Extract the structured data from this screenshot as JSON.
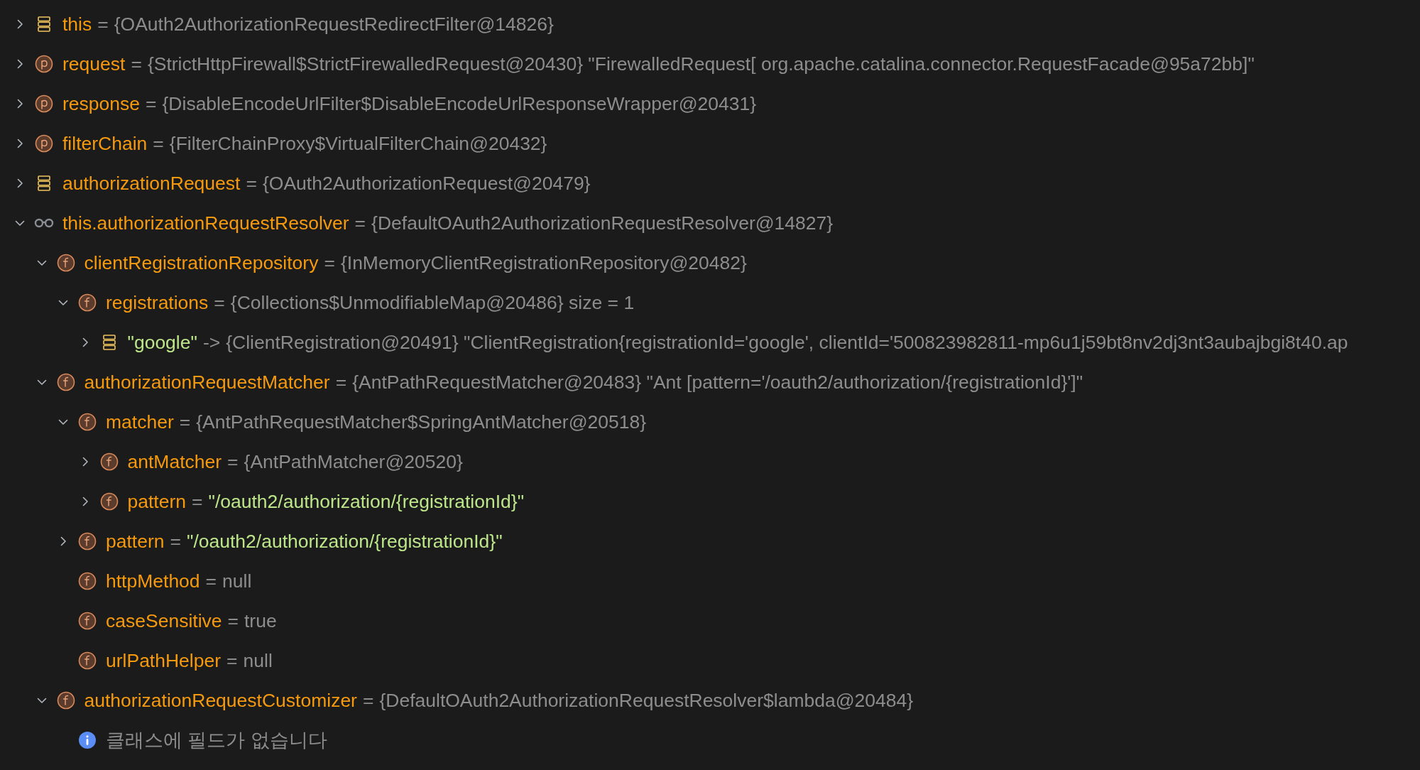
{
  "tree": [
    {
      "kind": "local",
      "name": "this",
      "separator": "=",
      "value": "{OAuth2AuthorizationRequestRedirectFilter@14826}",
      "expanded": false
    },
    {
      "kind": "param",
      "name": "request",
      "separator": "=",
      "value": "{StrictHttpFirewall$StrictFirewalledRequest@20430} \"FirewalledRequest[ org.apache.catalina.connector.RequestFacade@95a72bb]\"",
      "expanded": false
    },
    {
      "kind": "param",
      "name": "response",
      "separator": "=",
      "value": "{DisableEncodeUrlFilter$DisableEncodeUrlResponseWrapper@20431}",
      "expanded": false
    },
    {
      "kind": "param",
      "name": "filterChain",
      "separator": "=",
      "value": "{FilterChainProxy$VirtualFilterChain@20432}",
      "expanded": false
    },
    {
      "kind": "local",
      "name": "authorizationRequest",
      "separator": "=",
      "value": "{OAuth2AuthorizationRequest@20479}",
      "expanded": false
    },
    {
      "kind": "watch",
      "name": "this.authorizationRequestResolver",
      "separator": "=",
      "value": "{DefaultOAuth2AuthorizationRequestResolver@14827}",
      "expanded": true,
      "children": [
        {
          "kind": "field",
          "name": "clientRegistrationRepository",
          "separator": "=",
          "value": "{InMemoryClientRegistrationRepository@20482}",
          "expanded": true,
          "children": [
            {
              "kind": "field",
              "name": "registrations",
              "separator": "=",
              "value": "{Collections$UnmodifiableMap@20486}  size = 1",
              "expanded": true,
              "children": [
                {
                  "kind": "entry",
                  "name": "\"google\"",
                  "separator": "->",
                  "value": "{ClientRegistration@20491} \"ClientRegistration{registrationId='google', clientId='500823982811-mp6u1j59bt8nv2dj3nt3aubajbgi8t40.ap",
                  "expanded": false
                }
              ]
            }
          ]
        },
        {
          "kind": "field",
          "name": "authorizationRequestMatcher",
          "separator": "=",
          "value": "{AntPathRequestMatcher@20483} \"Ant [pattern='/oauth2/authorization/{registrationId}']\"",
          "expanded": true,
          "children": [
            {
              "kind": "field",
              "name": "matcher",
              "separator": "=",
              "value": "{AntPathRequestMatcher$SpringAntMatcher@20518}",
              "expanded": true,
              "children": [
                {
                  "kind": "field",
                  "name": "antMatcher",
                  "separator": "=",
                  "value": "{AntPathMatcher@20520}",
                  "expanded": false
                },
                {
                  "kind": "string",
                  "name": "pattern",
                  "separator": "=",
                  "value": "\"/oauth2/authorization/{registrationId}\"",
                  "expanded": false
                }
              ]
            },
            {
              "kind": "string",
              "name": "pattern",
              "separator": "=",
              "value": "\"/oauth2/authorization/{registrationId}\"",
              "expanded": false
            },
            {
              "kind": "field",
              "name": "httpMethod",
              "separator": "=",
              "value": "null"
            },
            {
              "kind": "field",
              "name": "caseSensitive",
              "separator": "=",
              "value": "true"
            },
            {
              "kind": "field",
              "name": "urlPathHelper",
              "separator": "=",
              "value": "null"
            }
          ]
        },
        {
          "kind": "field",
          "name": "authorizationRequestCustomizer",
          "separator": "=",
          "value": "{DefaultOAuth2AuthorizationRequestResolver$lambda@20484}",
          "expanded": true,
          "children": [
            {
              "kind": "info",
              "value": "클래스에 필드가 없습니다"
            }
          ]
        }
      ]
    }
  ]
}
